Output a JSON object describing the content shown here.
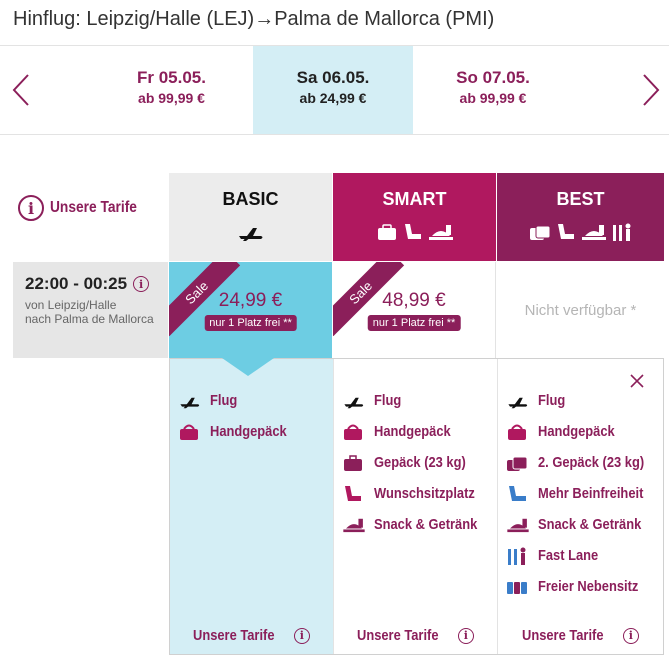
{
  "header": {
    "route_title": "Hinflug: Leipzig/Halle (LEJ)→Palma de Mallorca (PMI)"
  },
  "dates": [
    {
      "day": "Fr 05.05.",
      "price": "ab 99,99 €",
      "selected": false
    },
    {
      "day": "Sa 06.05.",
      "price": "ab 24,99 €",
      "selected": true
    },
    {
      "day": "So 07.05.",
      "price": "ab 99,99 €",
      "selected": false
    }
  ],
  "tarife_link": {
    "icon": "info-icon",
    "label": "Unsere Tarife"
  },
  "fares": [
    {
      "name": "BASIC",
      "color": "#ececec",
      "icons": [
        "plane-icon"
      ]
    },
    {
      "name": "SMART",
      "color": "#b0185f",
      "icons": [
        "bag-icon",
        "seat-icon",
        "snack-icon"
      ]
    },
    {
      "name": "BEST",
      "color": "#8b1f5a",
      "icons": [
        "bag-icon",
        "seat-icon",
        "snack-icon",
        "fastlane-icon"
      ]
    }
  ],
  "flight": {
    "time": "22:00 - 00:25",
    "route_line1": "von Leipzig/Halle",
    "route_line2": "nach Palma de Mallorca"
  },
  "prices": {
    "basic": {
      "sale": "Sale",
      "price": "24,99 €",
      "badge": "nur 1 Platz frei **"
    },
    "smart": {
      "sale": "Sale",
      "price": "48,99 €",
      "badge": "nur 1 Platz frei **"
    },
    "best": {
      "unavailable": "Nicht verfügbar *"
    }
  },
  "features": {
    "basic": [
      {
        "icon": "plane-icon",
        "label": "Flug"
      },
      {
        "icon": "handbag-icon",
        "label": "Handgepäck"
      }
    ],
    "smart": [
      {
        "icon": "plane-icon",
        "label": "Flug"
      },
      {
        "icon": "handbag-icon",
        "label": "Handgepäck"
      },
      {
        "icon": "suitcase-icon",
        "label": "Gepäck (23 kg)"
      },
      {
        "icon": "seat-icon",
        "label": "Wunschsitzplatz"
      },
      {
        "icon": "snack-icon",
        "label": "Snack & Getränk"
      }
    ],
    "best": [
      {
        "icon": "plane-icon",
        "label": "Flug"
      },
      {
        "icon": "handbag-icon",
        "label": "Handgepäck"
      },
      {
        "icon": "suitcases-icon",
        "label": "2. Gepäck (23 kg)"
      },
      {
        "icon": "legroom-icon",
        "label": "Mehr Beinfreiheit"
      },
      {
        "icon": "snack-icon",
        "label": "Snack & Getränk"
      },
      {
        "icon": "fastlane-icon",
        "label": "Fast Lane"
      },
      {
        "icon": "seats-icon",
        "label": "Freier Nebensitz"
      }
    ]
  },
  "footer_link": "Unsere Tarife",
  "colors": {
    "brand": "#8b1f5a",
    "smart": "#b0185f",
    "selected_bg": "#d4eef5",
    "basic_highlight": "#6dcde3"
  }
}
